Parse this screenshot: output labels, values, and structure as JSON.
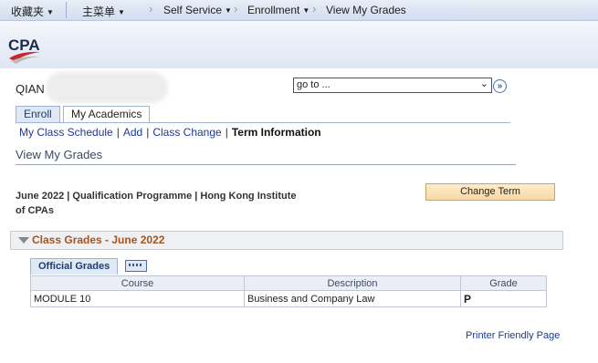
{
  "topnav": {
    "favorites": "收藏夹",
    "main_menu": "主菜单",
    "breadcrumb": [
      "Self Service",
      "Enrollment",
      "View My Grades"
    ]
  },
  "header": {
    "logo_text": "CPA"
  },
  "user": {
    "name": "QIAN"
  },
  "goto": {
    "value": "go to ..."
  },
  "tabs": [
    {
      "label": "Enroll"
    },
    {
      "label": "My Academics"
    }
  ],
  "subnav": {
    "items": [
      "My Class Schedule",
      "Add",
      "Class Change"
    ],
    "current": "Term Information"
  },
  "page_title": "View My Grades",
  "term_info": "June 2022 | Qualification Programme | Hong Kong Institute of CPAs",
  "change_term_button": "Change Term",
  "section": {
    "title": "Class Grades - June 2022"
  },
  "grid": {
    "tab_label": "Official Grades",
    "columns": [
      "Course",
      "Description",
      "Grade"
    ],
    "rows": [
      {
        "course": "MODULE 10",
        "description": "Business and Company Law",
        "grade": "P"
      }
    ]
  },
  "printer_link": "Printer Friendly Page",
  "colors": {
    "section_title": "#a9541c",
    "link": "#1c3a94",
    "accent": "#c8262c"
  }
}
